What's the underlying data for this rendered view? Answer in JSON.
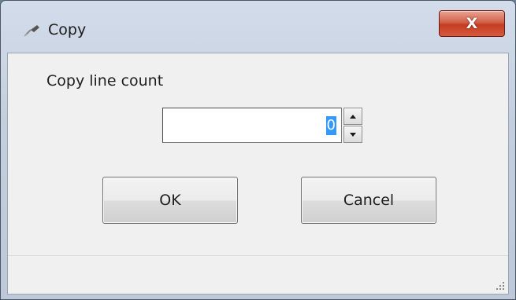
{
  "window": {
    "title": "Copy",
    "title_icon": "copy-tool-icon",
    "close_glyph": "X",
    "close_icon": "close-icon",
    "close_color": "#c8432a"
  },
  "form": {
    "field_label": "Copy line count",
    "spin_value": "0",
    "spin_up_icon": "spin-up-icon",
    "spin_down_icon": "spin-down-icon",
    "selection_color": "#3399ff"
  },
  "buttons": {
    "ok_label": "OK",
    "cancel_label": "Cancel"
  },
  "status": {
    "grip_icon": "resize-grip-icon"
  }
}
